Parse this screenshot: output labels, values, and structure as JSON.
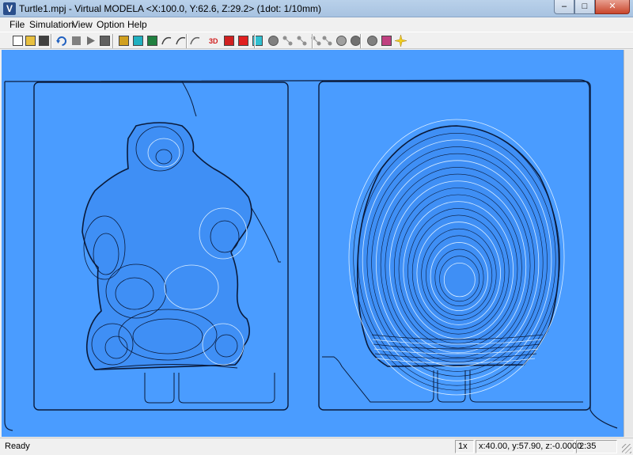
{
  "window": {
    "title": "Turtle1.mpj - Virtual MODELA  <X:100.0, Y:62.6, Z:29.2>  (1dot: 1/10mm)",
    "icon_letter": "V",
    "minimize_glyph": "–",
    "maximize_glyph": "□",
    "close_glyph": "✕"
  },
  "menu": {
    "items": [
      "File",
      "Simulation",
      "View",
      "Option",
      "Help"
    ]
  },
  "toolbar": {
    "buttons": [
      {
        "icon": "new-file-icon",
        "color": "#ffffff"
      },
      {
        "icon": "open-folder-icon",
        "color": "#e8c040"
      },
      {
        "icon": "save-icon",
        "color": "#404040"
      },
      {
        "icon": "rotate-view-icon",
        "color": "#2060c0"
      },
      {
        "icon": "stop-icon",
        "color": "#808080"
      },
      {
        "icon": "play-icon",
        "color": "#707070"
      },
      {
        "icon": "step-icon",
        "color": "#606060"
      },
      {
        "icon": "tool-icon",
        "color": "#d0a020"
      },
      {
        "icon": "workpiece-cyan-icon",
        "color": "#20b0c0"
      },
      {
        "icon": "surface-icon",
        "color": "#208040"
      },
      {
        "icon": "path-icon",
        "color": "#404040"
      },
      {
        "icon": "curve-icon",
        "color": "#404040"
      },
      {
        "icon": "line-icon",
        "color": "#606060"
      },
      {
        "icon": "3d-view-icon",
        "color": "#d02020"
      },
      {
        "icon": "red-arrow-icon",
        "color": "#d02020"
      },
      {
        "icon": "red-square-icon",
        "color": "#e02020"
      },
      {
        "icon": "cyan-square-icon",
        "color": "#30c0d0"
      },
      {
        "icon": "gray-sphere-icon",
        "color": "#808080"
      },
      {
        "icon": "node-1-icon",
        "color": "#909090"
      },
      {
        "icon": "node-2-icon",
        "color": "#909090"
      },
      {
        "icon": "node-3-icon",
        "color": "#909090"
      },
      {
        "icon": "node-4-icon",
        "color": "#909090"
      },
      {
        "icon": "sphere-outline-icon",
        "color": "#a0a0a0"
      },
      {
        "icon": "sphere-dark-icon",
        "color": "#707070"
      },
      {
        "icon": "sphere-shaded-icon",
        "color": "#808080"
      },
      {
        "icon": "color-settings-icon",
        "color": "#c04080"
      },
      {
        "icon": "light-burst-icon",
        "color": "#f0d020"
      }
    ]
  },
  "viewport": {
    "background_color": "#4a9cff",
    "model_color": "#3f8ff5",
    "contour_color": "#0a1a3a",
    "highlight_color": "#d8ecff"
  },
  "status": {
    "ready": "Ready",
    "zoom": "1x",
    "coords": "x:40.00, y:57.90, z:-0.0000",
    "time": "2:35"
  }
}
